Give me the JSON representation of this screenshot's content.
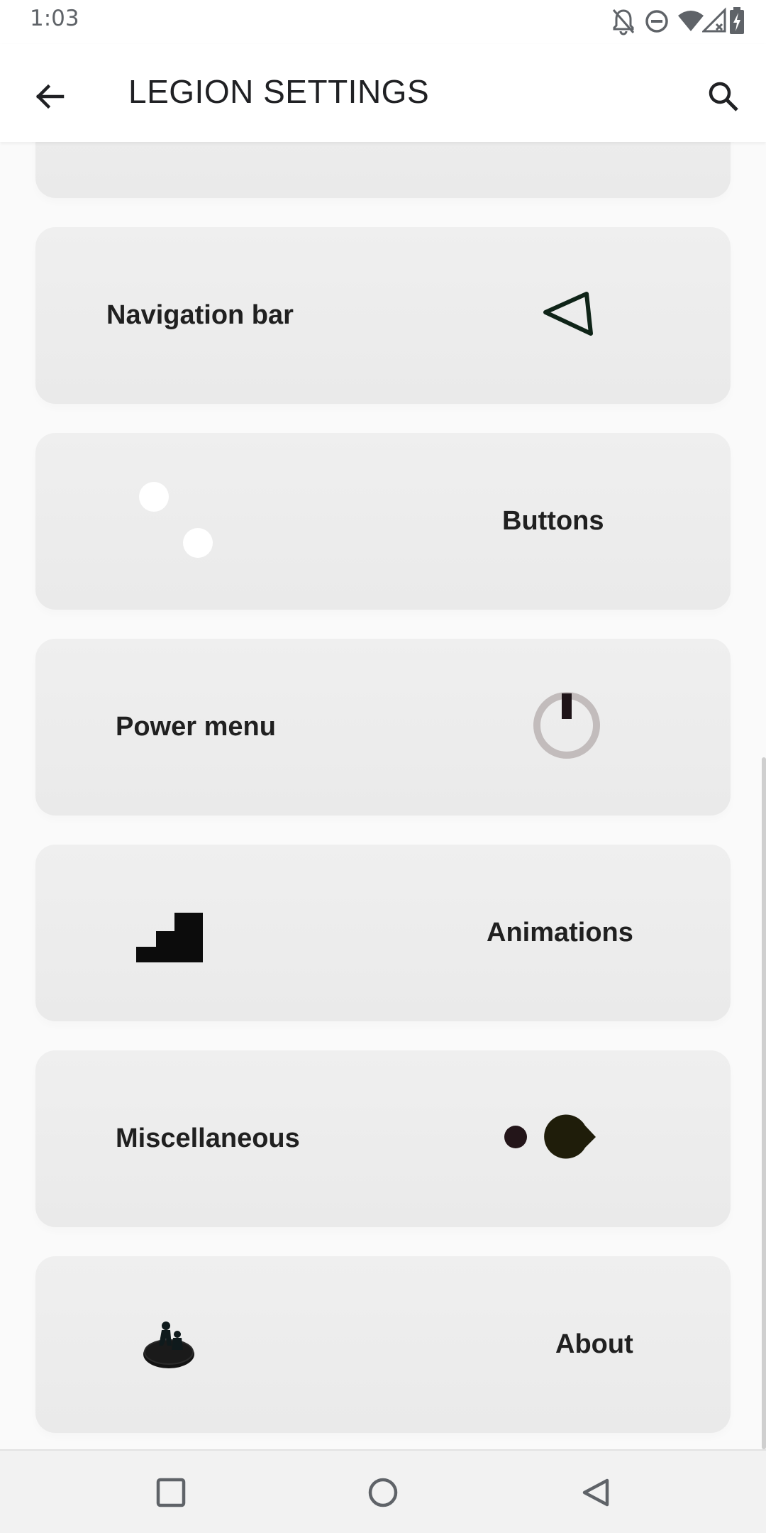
{
  "status_bar": {
    "time": "1:03",
    "icons": [
      "notifications-off-icon",
      "do-not-disturb-icon",
      "wifi-icon",
      "cell-signal-icon",
      "battery-charging-icon"
    ]
  },
  "app_bar": {
    "title": "LEGION SETTINGS",
    "back_icon": "arrow-left-icon",
    "search_icon": "search-icon"
  },
  "cards": [
    {
      "label": "Navigation bar",
      "icon": "triangle-back-icon"
    },
    {
      "label": "Buttons",
      "icon": "two-dots-icon"
    },
    {
      "label": "Power menu",
      "icon": "power-icon"
    },
    {
      "label": "Animations",
      "icon": "stairs-icon"
    },
    {
      "label": "Miscellaneous",
      "icon": "pacman-icon"
    },
    {
      "label": "About",
      "icon": "figures-on-disc-icon"
    }
  ],
  "nav_bar": {
    "recents_icon": "square-icon",
    "home_icon": "circle-icon",
    "back_icon": "triangle-icon"
  },
  "colors": {
    "card_background": "#ececec",
    "page_background": "#fafafa",
    "power_ring": "#c2bcbc",
    "dark_icon": "#1e1418"
  }
}
